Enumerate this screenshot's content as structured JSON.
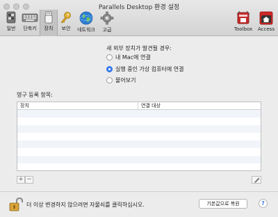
{
  "window": {
    "title": "Parallels Desktop 환경 설정"
  },
  "toolbar": {
    "items": [
      {
        "label": "일반",
        "icon": "switch-icon"
      },
      {
        "label": "단축키",
        "icon": "keyboard-icon"
      },
      {
        "label": "장치",
        "icon": "usb-icon",
        "selected": true
      },
      {
        "label": "보안",
        "icon": "key-icon"
      },
      {
        "label": "네트워크",
        "icon": "globe-icon"
      },
      {
        "label": "고급",
        "icon": "gear-icon"
      }
    ],
    "right_items": [
      {
        "label": "Toolbox",
        "icon": "toolbox-icon"
      },
      {
        "label": "Access",
        "icon": "access-icon"
      }
    ]
  },
  "devices": {
    "heading": "새 외부 장치가 발견될 경우:",
    "options": [
      {
        "label": "내 Mac에 연결",
        "selected": false
      },
      {
        "label": "실행 중인 가상 컴퓨터에 연결",
        "selected": true
      },
      {
        "label": "물어보기",
        "selected": false
      }
    ],
    "permanent_label": "영구 등록 항목:",
    "table": {
      "columns": [
        "장치",
        "연결 대상"
      ],
      "rows": []
    },
    "add_label": "+",
    "remove_label": "−"
  },
  "footer": {
    "lock_text": "더 이상 변경하지 않으려면 자물쇠를 클릭하십시오.",
    "restore_label": "기본값으로 복원",
    "help_label": "?"
  }
}
